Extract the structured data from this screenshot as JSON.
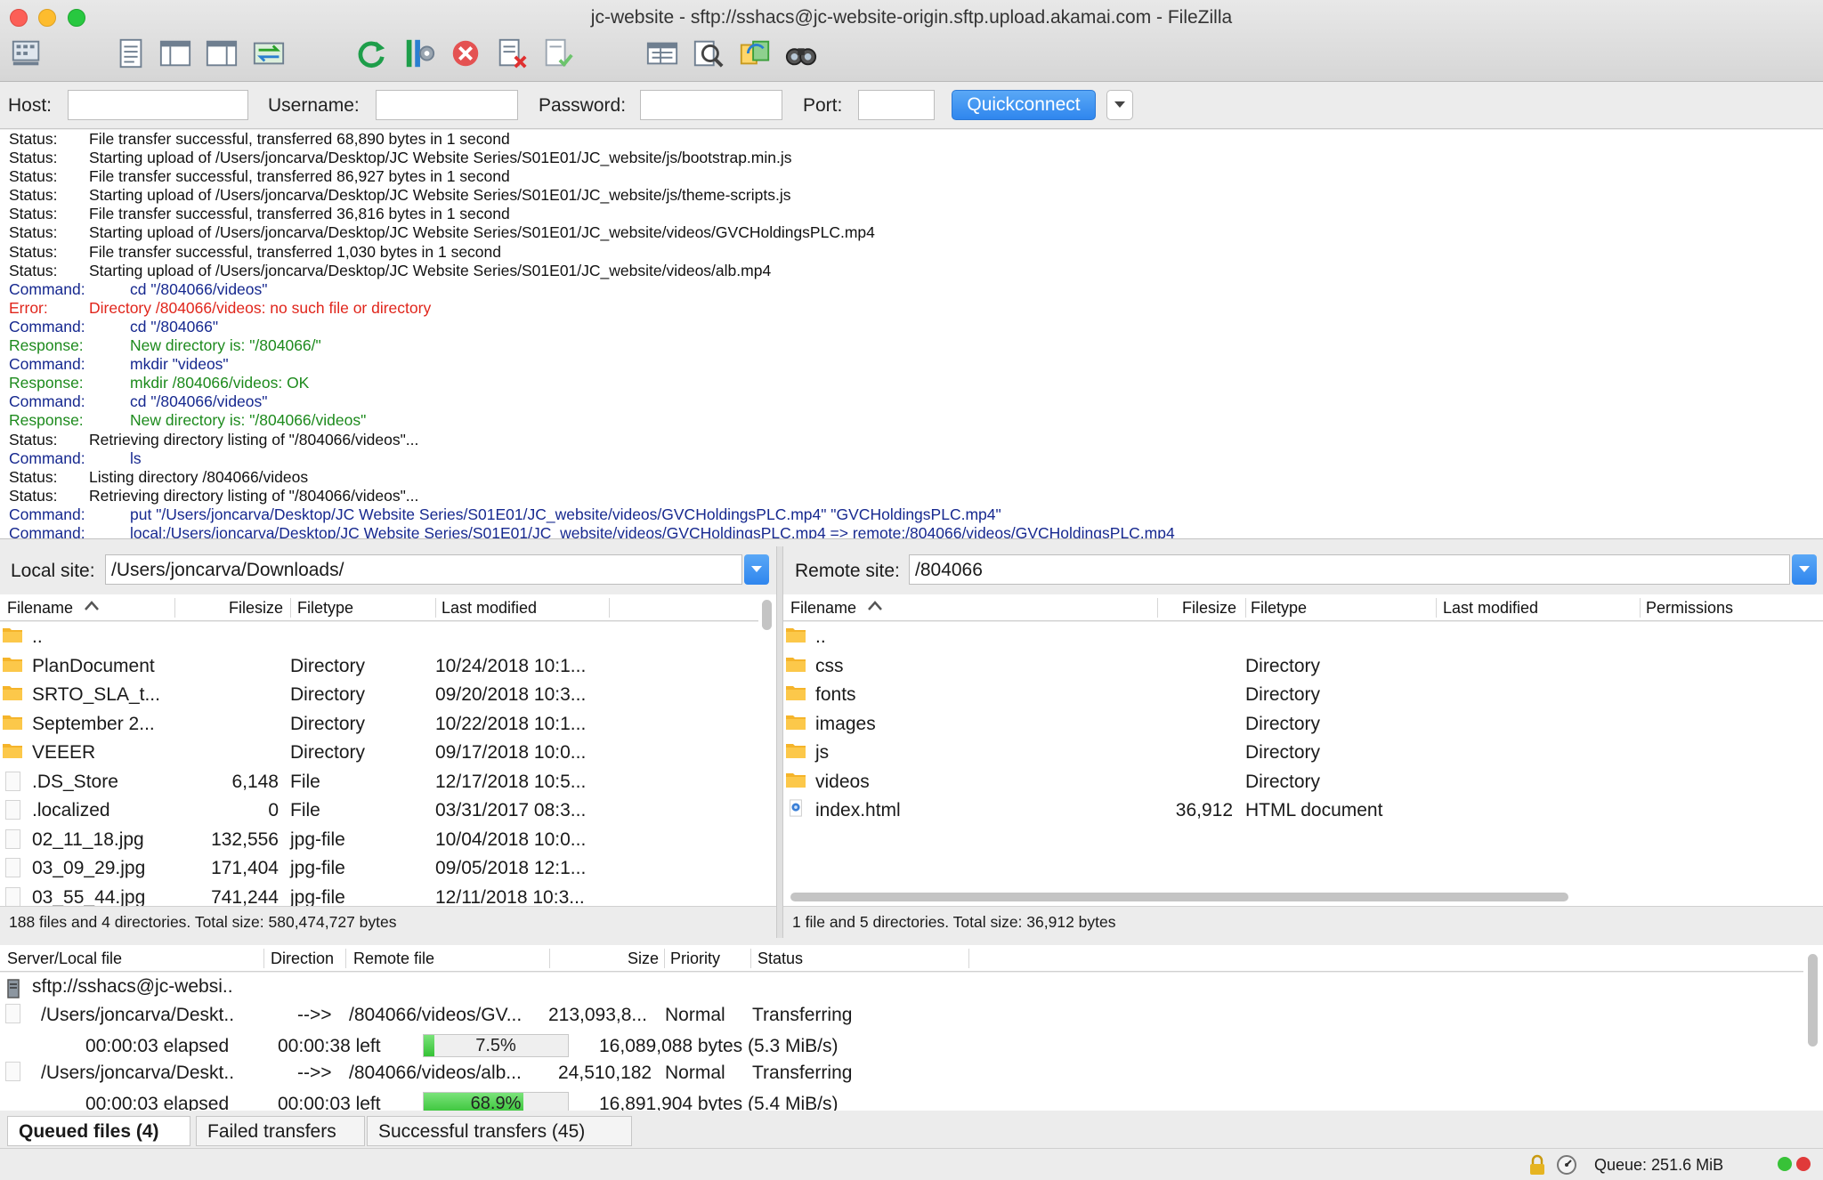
{
  "window": {
    "title": "jc-website - sftp://sshacs@jc-website-origin.sftp.upload.akamai.com - FileZilla"
  },
  "toolbar": {
    "icons": [
      "site-manager-icon",
      "message-log-icon",
      "local-tree-icon",
      "remote-tree-icon",
      "transfer-queue-icon",
      "refresh-icon",
      "process-queue-icon",
      "cancel-icon",
      "disconnect-icon",
      "reconnect-icon",
      "directory-listing-filters-icon",
      "toggle-comparison-icon",
      "synchronized-browsing-icon",
      "search-icon"
    ]
  },
  "quickconnect": {
    "host_label": "Host:",
    "username_label": "Username:",
    "password_label": "Password:",
    "port_label": "Port:",
    "host_value": "",
    "username_value": "",
    "password_value": "",
    "port_value": "",
    "button_label": "Quickconnect"
  },
  "log": [
    {
      "type": "Status:",
      "kind": "status",
      "msg": "File transfer successful, transferred 68,890 bytes in 1 second"
    },
    {
      "type": "Status:",
      "kind": "status",
      "msg": "Starting upload of /Users/joncarva/Desktop/JC Website Series/S01E01/JC_website/js/bootstrap.min.js"
    },
    {
      "type": "Status:",
      "kind": "status",
      "msg": "File transfer successful, transferred 86,927 bytes in 1 second"
    },
    {
      "type": "Status:",
      "kind": "status",
      "msg": "Starting upload of /Users/joncarva/Desktop/JC Website Series/S01E01/JC_website/js/theme-scripts.js"
    },
    {
      "type": "Status:",
      "kind": "status",
      "msg": "File transfer successful, transferred 36,816 bytes in 1 second"
    },
    {
      "type": "Status:",
      "kind": "status",
      "msg": "Starting upload of /Users/joncarva/Desktop/JC Website Series/S01E01/JC_website/videos/GVCHoldingsPLC.mp4"
    },
    {
      "type": "Status:",
      "kind": "status",
      "msg": "File transfer successful, transferred 1,030 bytes in 1 second"
    },
    {
      "type": "Status:",
      "kind": "status",
      "msg": "Starting upload of /Users/joncarva/Desktop/JC Website Series/S01E01/JC_website/videos/alb.mp4"
    },
    {
      "type": "Command:",
      "kind": "cmd",
      "msg": "cd \"/804066/videos\""
    },
    {
      "type": "Error:",
      "kind": "err",
      "msg": "Directory /804066/videos: no such file or directory"
    },
    {
      "type": "Command:",
      "kind": "cmd",
      "msg": "cd \"/804066\""
    },
    {
      "type": "Response:",
      "kind": "resp",
      "msg": "New directory is: \"/804066/\""
    },
    {
      "type": "Command:",
      "kind": "cmd",
      "msg": "mkdir \"videos\""
    },
    {
      "type": "Response:",
      "kind": "resp",
      "msg": "mkdir /804066/videos: OK"
    },
    {
      "type": "Command:",
      "kind": "cmd",
      "msg": "cd \"/804066/videos\""
    },
    {
      "type": "Response:",
      "kind": "resp",
      "msg": "New directory is: \"/804066/videos\""
    },
    {
      "type": "Status:",
      "kind": "status",
      "msg": "Retrieving directory listing of \"/804066/videos\"..."
    },
    {
      "type": "Command:",
      "kind": "cmd",
      "msg": "ls"
    },
    {
      "type": "Status:",
      "kind": "status",
      "msg": "Listing directory /804066/videos"
    },
    {
      "type": "Status:",
      "kind": "status",
      "msg": "Retrieving directory listing of \"/804066/videos\"..."
    },
    {
      "type": "Command:",
      "kind": "cmd",
      "msg": "put \"/Users/joncarva/Desktop/JC Website Series/S01E01/JC_website/videos/GVCHoldingsPLC.mp4\" \"GVCHoldingsPLC.mp4\""
    },
    {
      "type": "Command:",
      "kind": "cmd",
      "msg": "local:/Users/joncarva/Desktop/JC Website Series/S01E01/JC_website/videos/GVCHoldingsPLC.mp4 => remote:/804066/videos/GVCHoldingsPLC.mp4"
    }
  ],
  "local": {
    "site_label": "Local site:",
    "path": "/Users/joncarva/Downloads/",
    "columns": {
      "filename": "Filename",
      "filesize": "Filesize",
      "filetype": "Filetype",
      "modified": "Last modified"
    },
    "rows": [
      {
        "icon": "folder",
        "name": "..",
        "size": "",
        "type": "",
        "modified": ""
      },
      {
        "icon": "folder",
        "name": "PlanDocument",
        "size": "",
        "type": "Directory",
        "modified": "10/24/2018 10:1..."
      },
      {
        "icon": "folder",
        "name": "SRTO_SLA_t...",
        "size": "",
        "type": "Directory",
        "modified": "09/20/2018 10:3..."
      },
      {
        "icon": "folder",
        "name": "September 2...",
        "size": "",
        "type": "Directory",
        "modified": "10/22/2018 10:1..."
      },
      {
        "icon": "folder",
        "name": "VEEER",
        "size": "",
        "type": "Directory",
        "modified": "09/17/2018 10:0..."
      },
      {
        "icon": "file",
        "name": ".DS_Store",
        "size": "6,148",
        "type": "File",
        "modified": "12/17/2018 10:5..."
      },
      {
        "icon": "file",
        "name": ".localized",
        "size": "0",
        "type": "File",
        "modified": "03/31/2017 08:3..."
      },
      {
        "icon": "file",
        "name": "02_11_18.jpg",
        "size": "132,556",
        "type": "jpg-file",
        "modified": "10/04/2018 10:0..."
      },
      {
        "icon": "file",
        "name": "03_09_29.jpg",
        "size": "171,404",
        "type": "jpg-file",
        "modified": "09/05/2018 12:1..."
      },
      {
        "icon": "file",
        "name": "03_55_44.jpg",
        "size": "741,244",
        "type": "jpg-file",
        "modified": "12/11/2018 10:3..."
      }
    ],
    "footer": "188 files and 4 directories. Total size: 580,474,727 bytes"
  },
  "remote": {
    "site_label": "Remote site:",
    "path": "/804066",
    "columns": {
      "filename": "Filename",
      "filesize": "Filesize",
      "filetype": "Filetype",
      "modified": "Last modified",
      "permissions": "Permissions"
    },
    "rows": [
      {
        "icon": "folder",
        "name": "..",
        "size": "",
        "type": ""
      },
      {
        "icon": "folder",
        "name": "css",
        "size": "",
        "type": "Directory"
      },
      {
        "icon": "folder",
        "name": "fonts",
        "size": "",
        "type": "Directory"
      },
      {
        "icon": "folder",
        "name": "images",
        "size": "",
        "type": "Directory"
      },
      {
        "icon": "folder",
        "name": "js",
        "size": "",
        "type": "Directory"
      },
      {
        "icon": "folder",
        "name": "videos",
        "size": "",
        "type": "Directory"
      },
      {
        "icon": "html",
        "name": "index.html",
        "size": "36,912",
        "type": "HTML document"
      }
    ],
    "footer": "1 file and 5 directories. Total size: 36,912 bytes"
  },
  "queue": {
    "columns": {
      "local": "Server/Local file",
      "direction": "Direction",
      "remote": "Remote file",
      "size": "Size",
      "priority": "Priority",
      "status": "Status"
    },
    "server": "sftp://sshacs@jc-websi..",
    "items": [
      {
        "local": "/Users/joncarva/Deskt..",
        "direction": "-->>",
        "remote": "/804066/videos/GV...",
        "size": "213,093,8...",
        "priority": "Normal",
        "status": "Transferring",
        "elapsed": "00:00:03 elapsed",
        "left": "00:00:38 left",
        "progress": 0.075,
        "progress_label": "7.5%",
        "bytes": "16,089,088 bytes (5.3 MiB/s)"
      },
      {
        "local": "/Users/joncarva/Deskt..",
        "direction": "-->>",
        "remote": "/804066/videos/alb...",
        "size": "24,510,182",
        "priority": "Normal",
        "status": "Transferring",
        "elapsed": "00:00:03 elapsed",
        "left": "00:00:03 left",
        "progress": 0.689,
        "progress_label": "68.9%",
        "bytes": "16,891,904 bytes (5.4 MiB/s)"
      }
    ],
    "tabs": [
      "Queued files (4)",
      "Failed transfers",
      "Successful transfers (45)"
    ]
  },
  "statusbar": {
    "queue": "Queue: 251.6 MiB"
  },
  "colors": {
    "status": "#111111",
    "command": "#16288f",
    "error": "#e0251b",
    "response": "#1c8a1c",
    "accent": "#2f86ee",
    "progress": "#35c235"
  }
}
